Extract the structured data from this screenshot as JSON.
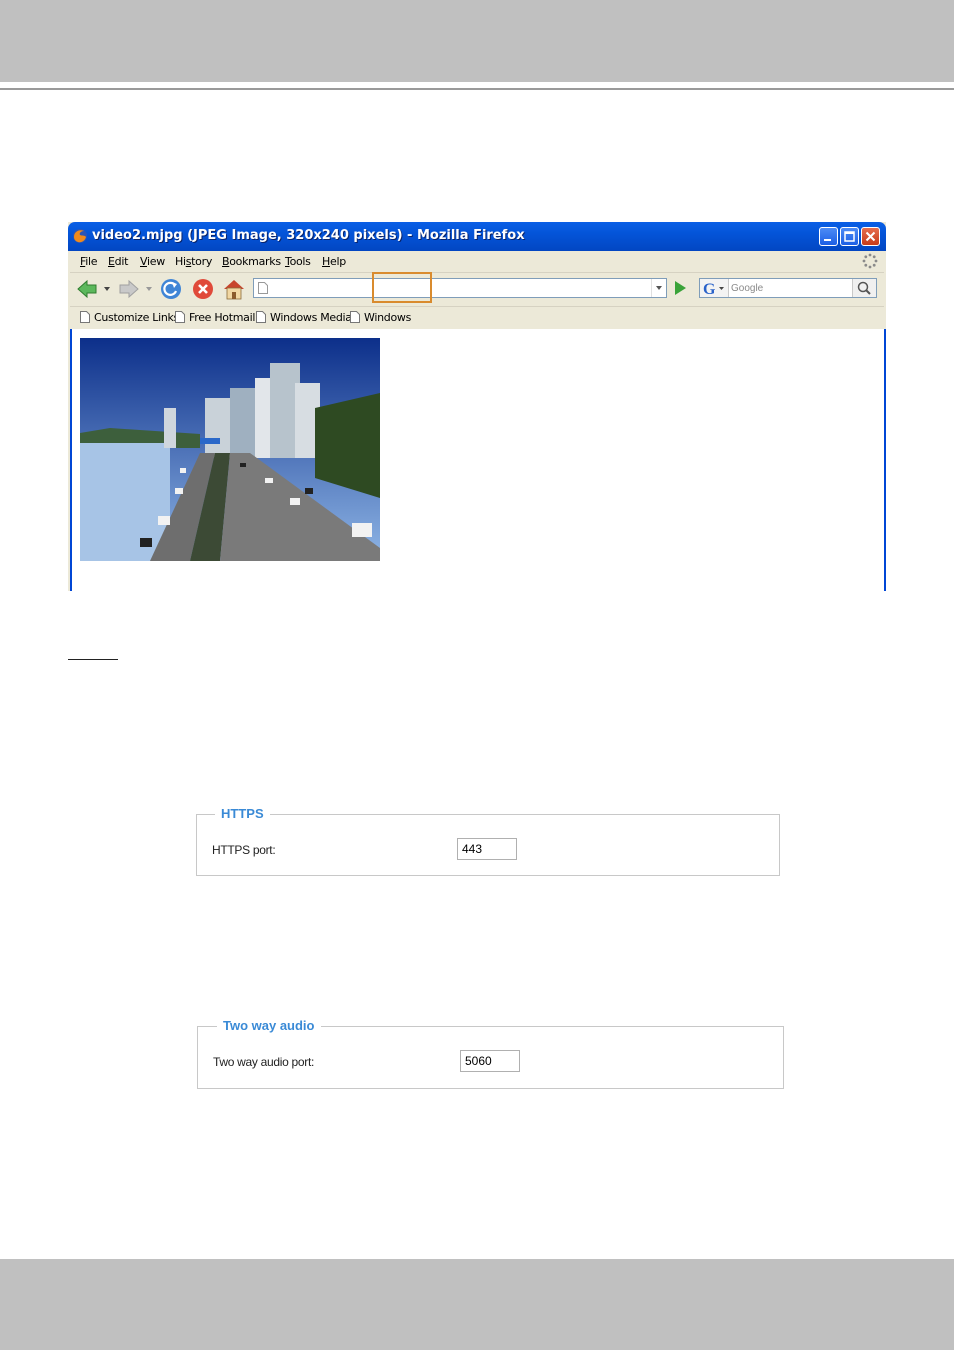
{
  "browser": {
    "title": "video2.mjpg (JPEG Image, 320x240 pixels) - Mozilla Firefox",
    "menu": [
      {
        "key": "F",
        "rest": "ile"
      },
      {
        "key": "E",
        "rest": "dit"
      },
      {
        "key": "V",
        "rest": "iew"
      },
      {
        "pre": "Hi",
        "key": "s",
        "rest": "tory"
      },
      {
        "key": "B",
        "rest": "ookmarks"
      },
      {
        "key": "T",
        "rest": "ools"
      },
      {
        "key": "H",
        "rest": "elp"
      }
    ],
    "url_value": "",
    "search_placeholder": "Google",
    "bookmarks": [
      "Customize Links",
      "Free Hotmail",
      "Windows Media",
      "Windows"
    ],
    "colors": {
      "titlebar": "#0454d8",
      "highlight": "#d98b2e"
    }
  },
  "https_panel": {
    "legend": "HTTPS",
    "port_label": "HTTPS port:",
    "port_value": "443"
  },
  "audio_panel": {
    "legend": "Two way audio",
    "port_label": "Two way audio port:",
    "port_value": "5060"
  }
}
